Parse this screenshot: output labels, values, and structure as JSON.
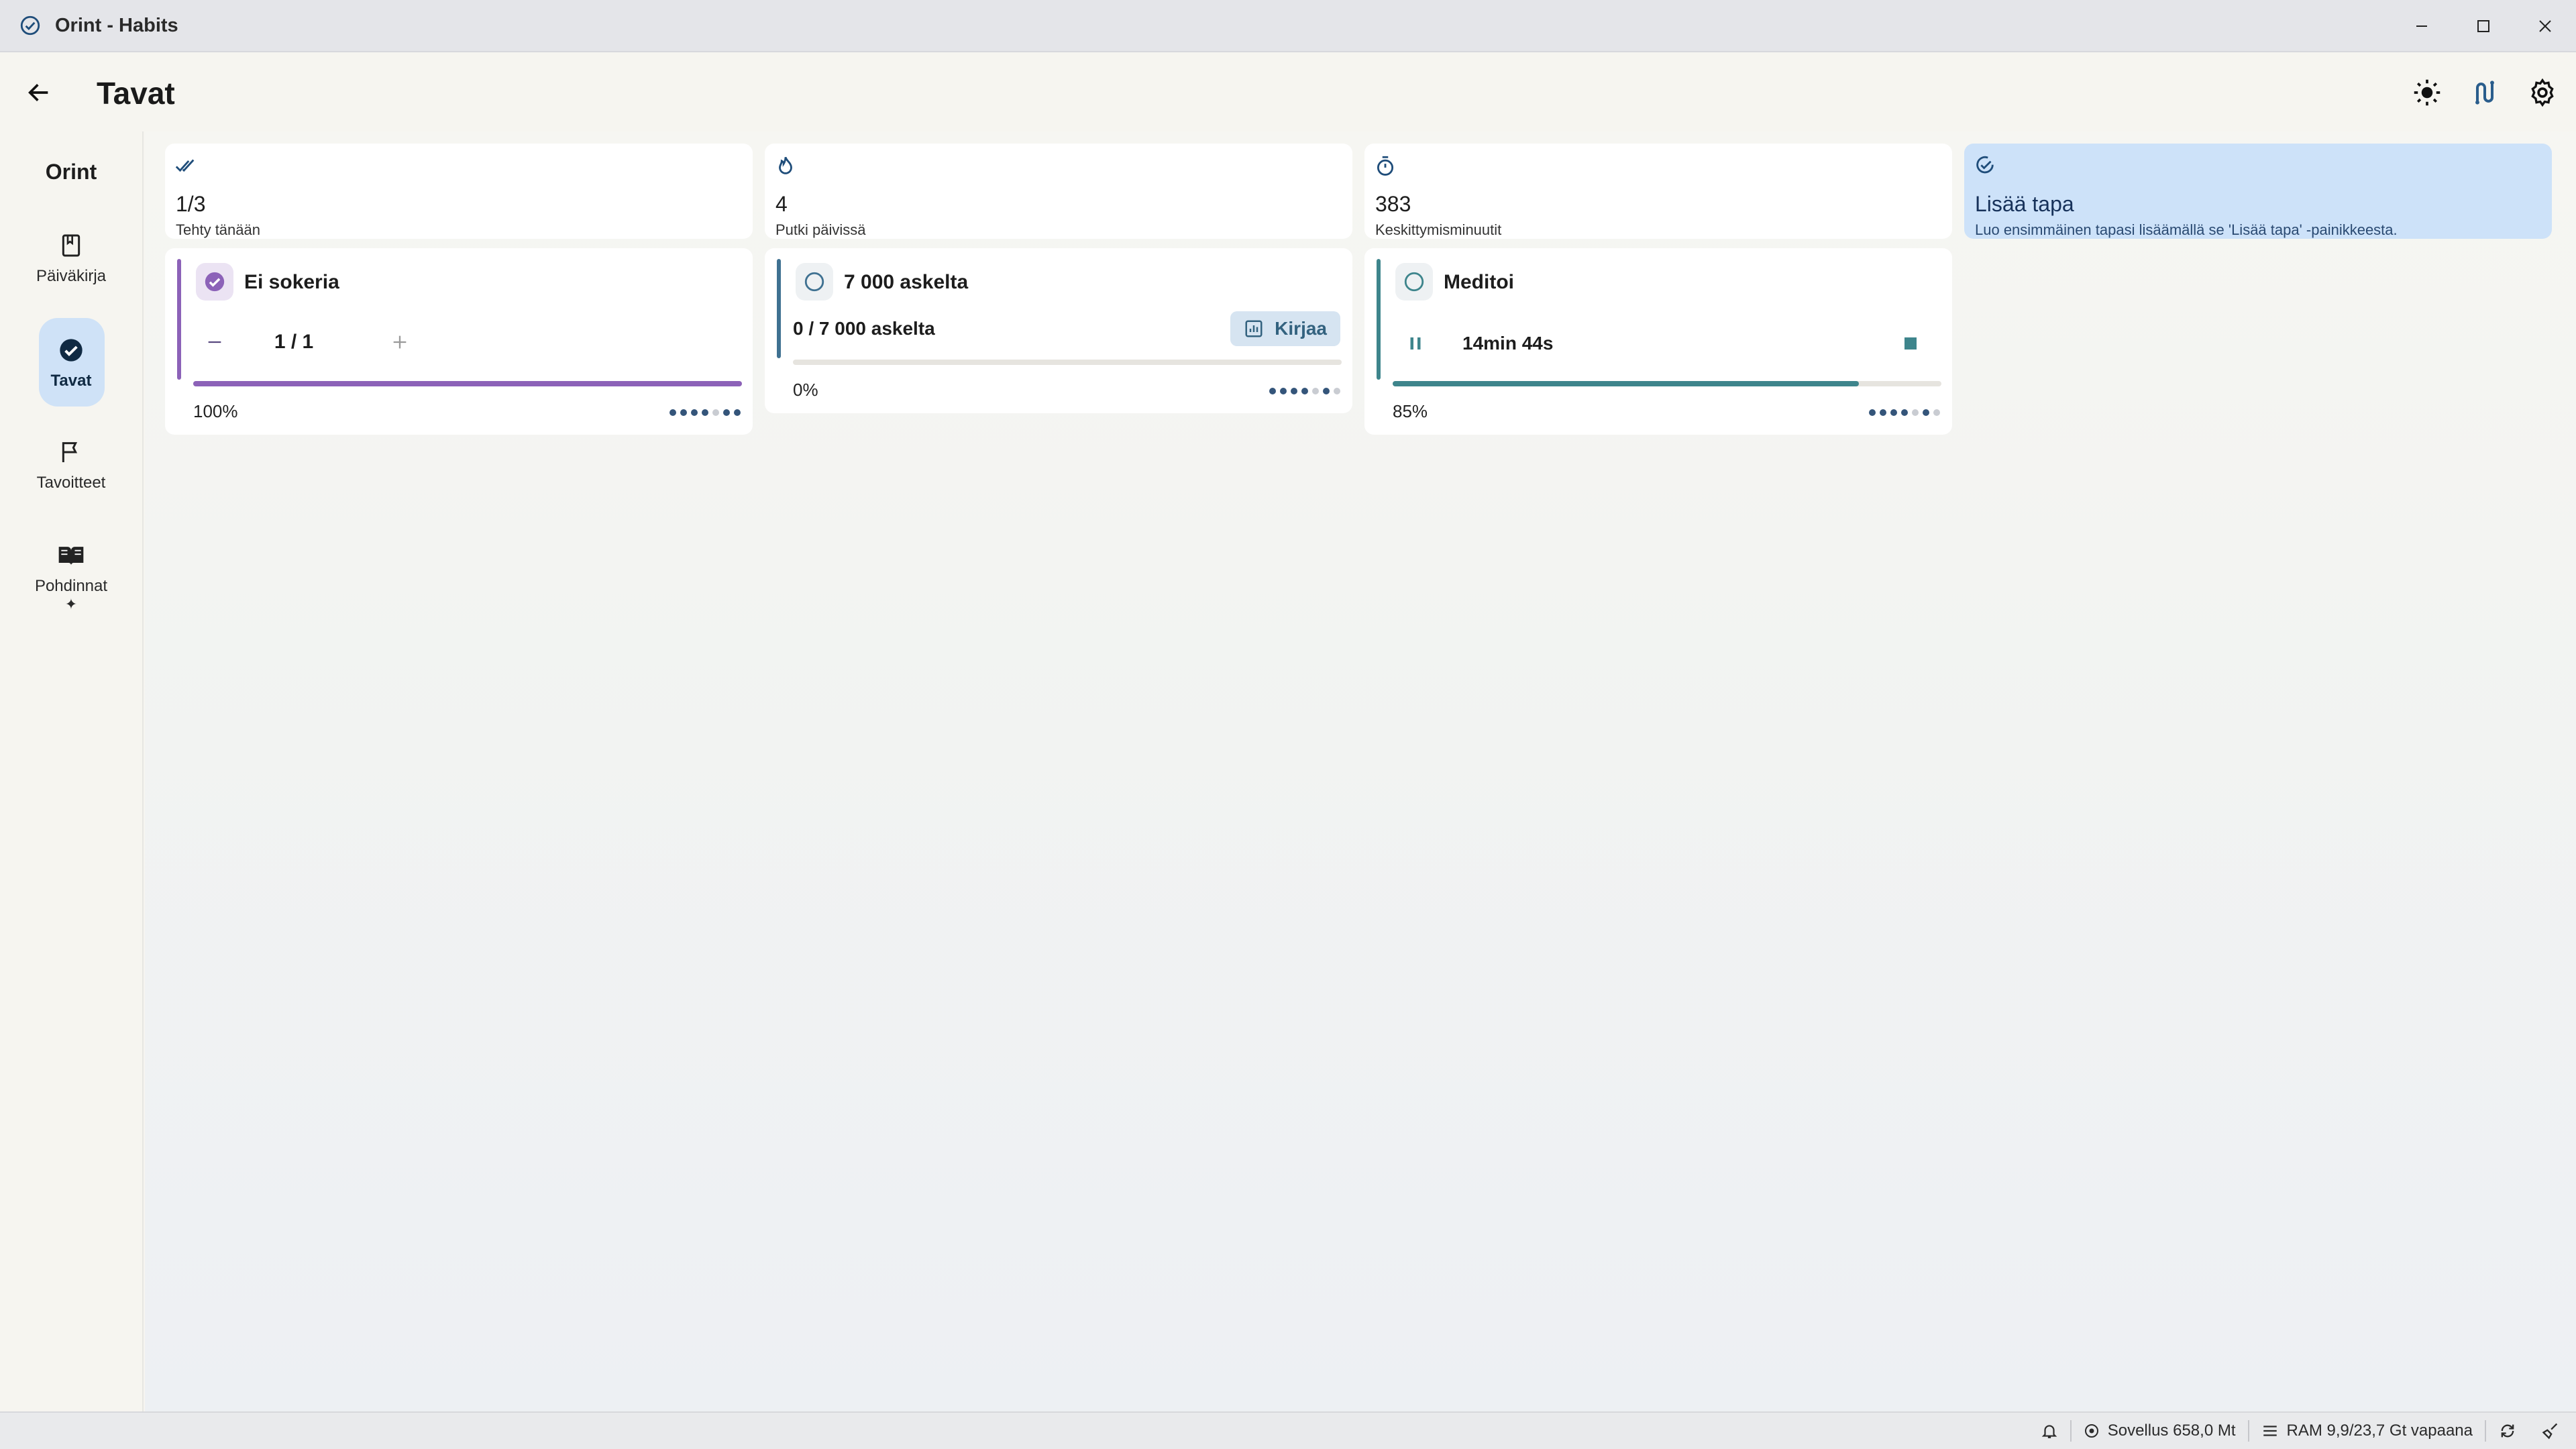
{
  "window": {
    "title": "Orint - Habits",
    "minimize_icon": "minimize-icon",
    "maximize_icon": "maximize-icon",
    "close_icon": "close-icon"
  },
  "header": {
    "title": "Tavat",
    "back_icon": "arrow-left-icon",
    "theme_icon": "sun-icon",
    "route_icon": "route-icon",
    "settings_icon": "gear-icon"
  },
  "sidebar": {
    "brand": "Orint",
    "items": [
      {
        "label": "Päiväkirja",
        "icon": "bookmark-icon",
        "active": false
      },
      {
        "label": "Tavat",
        "icon": "check-circle-icon",
        "active": true
      },
      {
        "label": "Tavoitteet",
        "icon": "flag-icon",
        "active": false
      },
      {
        "label": "Pohdinnat",
        "icon": "open-book-icon",
        "active": false,
        "badge": "✦"
      }
    ]
  },
  "stats": [
    {
      "value": "1/3",
      "label": "Tehty tänään",
      "icon": "double-check-icon"
    },
    {
      "value": "4",
      "label": "Putki päivissä",
      "icon": "flame-icon"
    },
    {
      "value": "383",
      "label": "Keskittymisminuutit",
      "icon": "stopwatch-icon"
    },
    {
      "value": "Lisää tapa",
      "label": "Luo ensimmäinen tapasi lisäämällä se 'Lisää tapa' -painikkeesta.",
      "icon": "add-check-icon"
    }
  ],
  "habits": [
    {
      "name": "Ei sokeria",
      "count": "1 / 1",
      "percent": "100%",
      "progress": 1.0,
      "color": "#8c62b8",
      "done": true,
      "history": [
        1,
        1,
        1,
        1,
        0,
        1,
        1
      ]
    },
    {
      "name": "7 000 askelta",
      "value": "0 / 7 000 askelta",
      "log_label": "Kirjaa",
      "percent": "0%",
      "progress": 0.0,
      "color": "#3f7191",
      "done": false,
      "history": [
        1,
        1,
        1,
        1,
        0,
        1,
        0
      ]
    },
    {
      "name": "Meditoi",
      "timer": "14min 44s",
      "percent": "85%",
      "progress": 0.85,
      "color": "#3e858c",
      "done": false,
      "history": [
        1,
        1,
        1,
        1,
        0,
        1,
        0
      ]
    }
  ],
  "statusbar": {
    "app_memory": "Sovellus 658,0 Mt",
    "ram": "RAM 9,9/23,7 Gt vapaana"
  },
  "colors": {
    "accent": "#1f4d7a",
    "active_pill": "#cfe2f7",
    "add_card": "#cde2f9"
  }
}
